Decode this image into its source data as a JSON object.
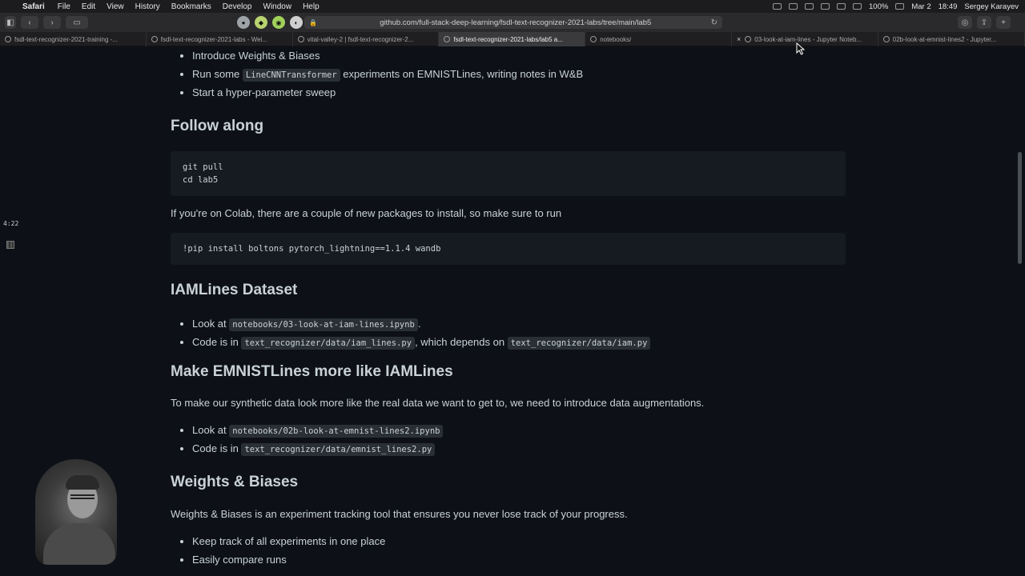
{
  "menubar": {
    "app": "Safari",
    "menus": [
      "File",
      "Edit",
      "View",
      "History",
      "Bookmarks",
      "Develop",
      "Window",
      "Help"
    ],
    "battery": "100%",
    "date": "Mar 2",
    "time": "18:49",
    "user": "Sergey Karayev"
  },
  "toolbar": {
    "url": "github.com/full-stack-deep-learning/fsdl-text-recognizer-2021-labs/tree/main/lab5"
  },
  "tabs": [
    {
      "label": "fsdl-text-recognizer-2021-training -..."
    },
    {
      "label": "fsdl-text-recognizer-2021-labs - Wei..."
    },
    {
      "label": "vital-valley-2 | fsdl-text-recognizer-2..."
    },
    {
      "label": "fsdl-text-recognizer-2021-labs/lab5 a...",
      "active": true
    },
    {
      "label": "notebooks/"
    },
    {
      "label": "03-look-at-iam-lines - Jupyter Noteb..."
    },
    {
      "label": "02b-look-at-emnist-lines2 - Jupyter..."
    }
  ],
  "overlay": {
    "time_label": "4:22"
  },
  "article": {
    "intro_items": [
      {
        "text": "Introduce Weights & Biases"
      },
      {
        "before": "Run some",
        "code": "LineCNNTransformer",
        "after": "experiments on EMNISTLines, writing notes in W&B"
      },
      {
        "text": "Start a hyper-parameter sweep"
      }
    ],
    "follow_along": {
      "heading": "Follow along",
      "code_lines": [
        "git pull",
        "cd lab5"
      ],
      "colab_text": "If you're on Colab, there are a couple of new packages to install, so make sure to run",
      "colab_code": "!pip install boltons pytorch_lightning==1.1.4 wandb"
    },
    "iamlines": {
      "heading": "IAMLines Dataset",
      "item1_before": "Look at",
      "item1_code": "notebooks/03-look-at-iam-lines.ipynb",
      "item1_after": ".",
      "item2_before": "Code is in",
      "item2_code": "text_recognizer/data/iam_lines.py",
      "item2_middle": ", which depends on",
      "item2_code2": "text_recognizer/data/iam.py"
    },
    "emnist": {
      "heading": "Make EMNISTLines more like IAMLines",
      "text": "To make our synthetic data look more like the real data we want to get to, we need to introduce data augmentations.",
      "item1_before": "Look at",
      "item1_code": "notebooks/02b-look-at-emnist-lines2.ipynb",
      "item2_before": "Code is in",
      "item2_code": "text_recognizer/data/emnist_lines2.py"
    },
    "wandb": {
      "heading": "Weights & Biases",
      "text": "Weights & Biases is an experiment tracking tool that ensures you never lose track of your progress.",
      "items": [
        "Keep track of all experiments in one place",
        "Easily compare runs"
      ]
    }
  }
}
